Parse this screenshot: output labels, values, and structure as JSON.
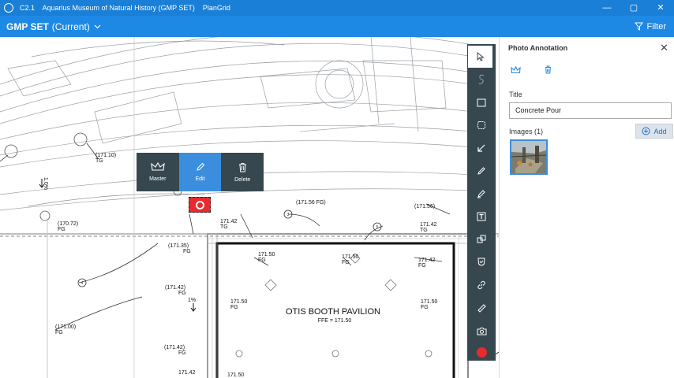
{
  "titlebar": {
    "title": "C2.1    Aquarius Museum of Natural History (GMP SET)    PlanGrid",
    "minimize": "—",
    "restore": "▢",
    "close": "✕"
  },
  "toolbar": {
    "set_name": "GMP SET",
    "set_status": "(Current)",
    "filter_label": "Filter"
  },
  "popup": {
    "master_label": "Master",
    "edit_label": "Edit",
    "delete_label": "Delete",
    "active": "Edit"
  },
  "drawing": {
    "building_name": "OTIS BOOTH PAVILION",
    "ffe": "FFE = 171.50",
    "elevations": [
      "(171.10)",
      "(171.56 FG)",
      "(171.56)",
      "171.42",
      "(170.72)",
      "(171.35)",
      "171.50",
      "171.50",
      "171.42",
      "(171.42)",
      "171.50",
      "171.50",
      "(171.00)",
      "(171.42)",
      "171.42",
      "171.50",
      "1.0%",
      "1%",
      "TG",
      "FG"
    ]
  },
  "tools": [
    "select-tool-icon",
    "lasso-tool-icon",
    "rectangle-tool-icon",
    "cloud-tool-icon",
    "arrow-tool-icon",
    "pen-tool-icon",
    "highlighter-tool-icon",
    "text-tool-icon",
    "shapes-tool-icon",
    "stamp-tool-icon",
    "link-tool-icon",
    "measure-tool-icon",
    "camera-tool-icon",
    "color-picker-icon"
  ],
  "colors": {
    "titlebar": "#1a7fd6",
    "toolbar": "#1e88e5",
    "tools_bg": "#37474f",
    "accent": "#3b8ede",
    "pin": "#e8292d"
  },
  "panel": {
    "title": "Photo Annotation",
    "close": "✕",
    "title_label": "Title",
    "title_value": "Concrete Pour",
    "images_label": "Images (1)",
    "add_label": "Add"
  }
}
